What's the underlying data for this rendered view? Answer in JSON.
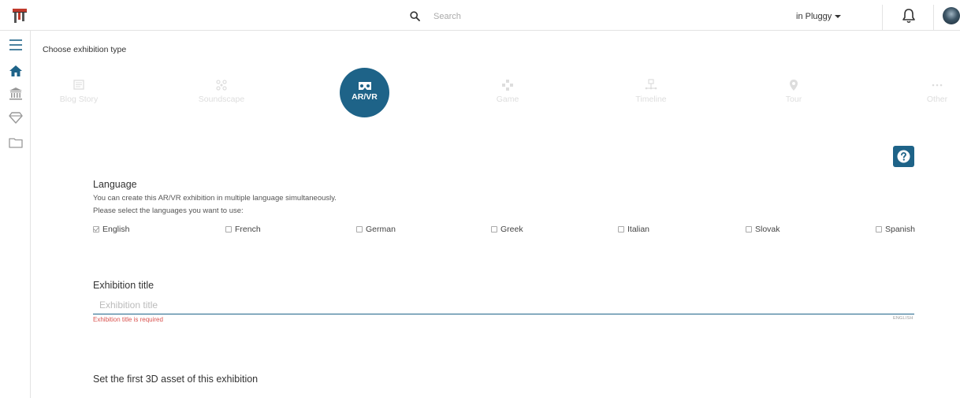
{
  "header": {
    "search_placeholder": "Search",
    "context_label": "in Pluggy"
  },
  "icons": {
    "logo": "pluggy-logo-icon",
    "search": "search-icon",
    "bell": "bell-icon",
    "menu": "hamburger-menu-icon",
    "home": "home-icon",
    "museum": "museum-icon",
    "gem": "gem-icon",
    "folder": "folder-icon",
    "help": "question-icon"
  },
  "page": {
    "choose_label": "Choose exhibition type"
  },
  "exhibition_types": [
    {
      "label": "Blog Story",
      "icon": "newspaper-icon",
      "active": false
    },
    {
      "label": "Soundscape",
      "icon": "soundscape-icon",
      "active": false
    },
    {
      "label": "AR/VR",
      "icon": "vr-headset-icon",
      "active": true
    },
    {
      "label": "Game",
      "icon": "gamepad-icon",
      "active": false
    },
    {
      "label": "Timeline",
      "icon": "timeline-icon",
      "active": false
    },
    {
      "label": "Tour",
      "icon": "map-marker-icon",
      "active": false
    },
    {
      "label": "Other",
      "icon": "ellipsis-icon",
      "active": false
    }
  ],
  "language": {
    "title": "Language",
    "help_line1": "You can create this AR/VR exhibition in multiple language simultaneously.",
    "help_line2": "Please select the languages you want to use:",
    "options": [
      {
        "label": "English",
        "checked": true
      },
      {
        "label": "French",
        "checked": false
      },
      {
        "label": "German",
        "checked": false
      },
      {
        "label": "Greek",
        "checked": false
      },
      {
        "label": "Italian",
        "checked": false
      },
      {
        "label": "Slovak",
        "checked": false
      },
      {
        "label": "Spanish",
        "checked": false
      }
    ]
  },
  "exhibition_title": {
    "title": "Exhibition title",
    "placeholder": "Exhibition title",
    "value": "",
    "error": "Exhibition title is required",
    "language_tag": "ENGLISH"
  },
  "asset_section": {
    "title": "Set the first 3D asset of this exhibition"
  },
  "colors": {
    "accent": "#1e6388",
    "error": "#d9534f",
    "inactive_type": "#dddddd"
  }
}
